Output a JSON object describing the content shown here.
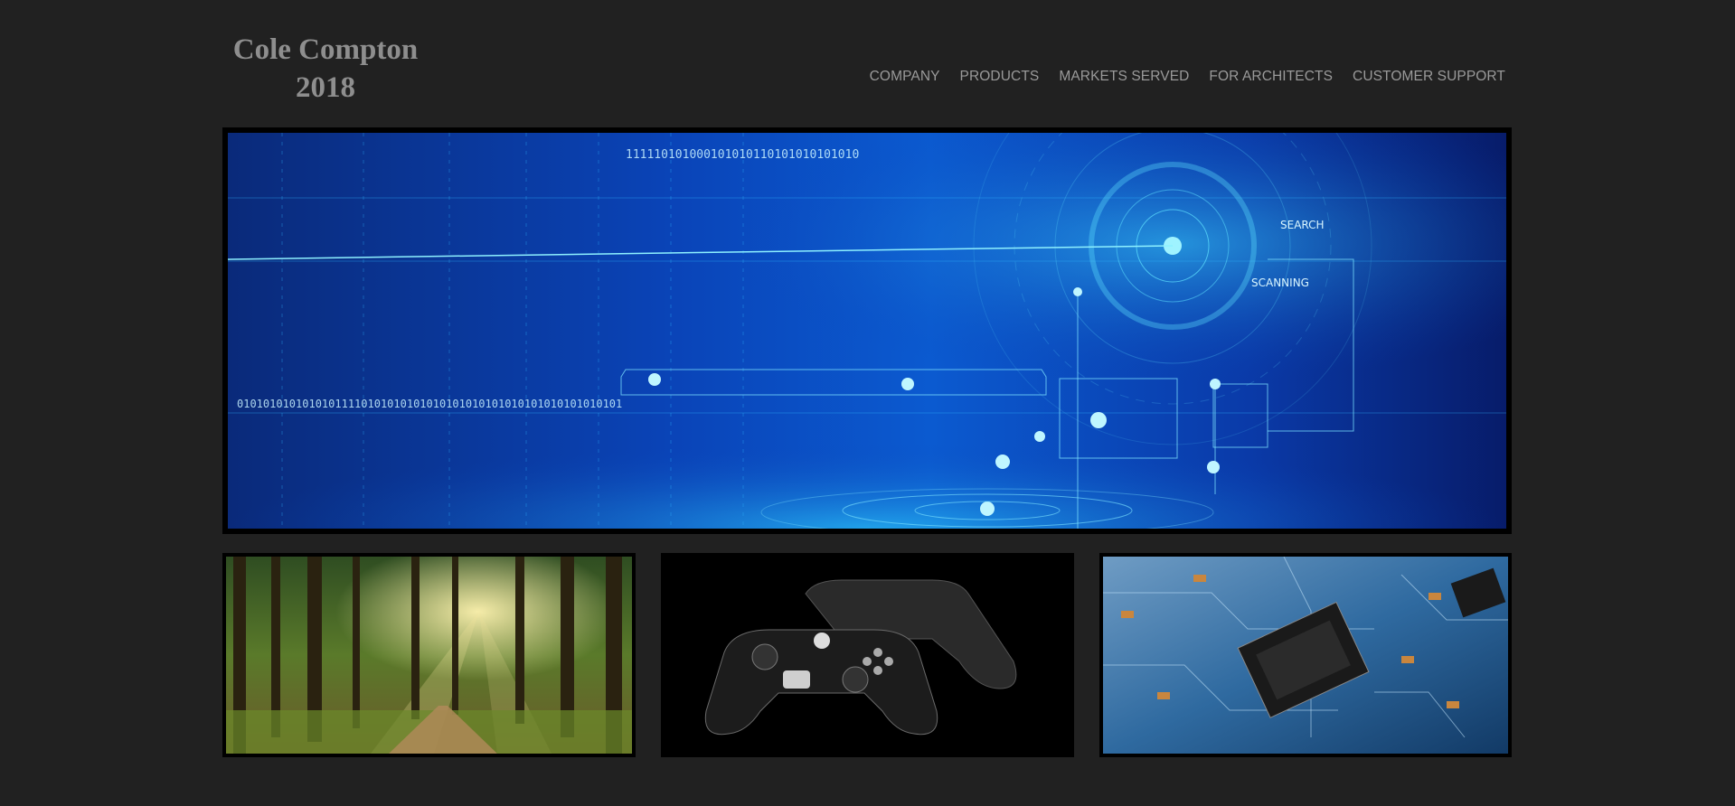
{
  "site": {
    "title_line1": "Cole Compton",
    "title_line2": "2018"
  },
  "nav": {
    "items": [
      {
        "label": "COMPANY"
      },
      {
        "label": "PRODUCTS"
      },
      {
        "label": "MARKETS SERVED"
      },
      {
        "label": "FOR ARCHITECTS"
      },
      {
        "label": "CUSTOMER SUPPORT"
      }
    ]
  },
  "hero": {
    "image": "technology-digital-interface-banner",
    "labels": [
      "SEARCH",
      "SCANNING"
    ],
    "binary_top": "111110101000101010110101010101010",
    "binary_mid": "01010101010101011110101010101010101010101010101010101010101"
  },
  "gallery": [
    {
      "image": "forest-sunlight-path"
    },
    {
      "image": "game-controllers"
    },
    {
      "image": "circuit-board-chip"
    }
  ],
  "colors": {
    "background": "#212121",
    "text_gray": "#8e8e8e",
    "frame": "#000000",
    "hero_blue": "#0b5ad0",
    "hero_cyan": "#39d0ff"
  }
}
